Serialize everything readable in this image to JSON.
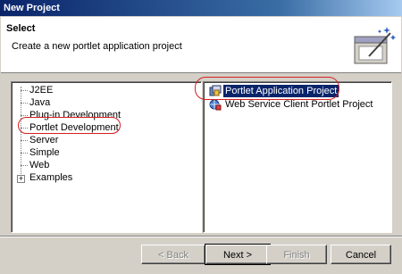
{
  "window": {
    "title": "New Project"
  },
  "banner": {
    "heading": "Select",
    "description": "Create a new portlet application project"
  },
  "categories": [
    {
      "label": "J2EE"
    },
    {
      "label": "Java"
    },
    {
      "label": "Plug-in Development"
    },
    {
      "label": "Portlet Development"
    },
    {
      "label": "Server"
    },
    {
      "label": "Simple"
    },
    {
      "label": "Web"
    },
    {
      "label": "Examples"
    }
  ],
  "projects": [
    {
      "label": "Portlet Application Project"
    },
    {
      "label": "Web Service Client Portlet Project"
    }
  ],
  "buttons": {
    "back": "< Back",
    "next": "Next >",
    "finish": "Finish",
    "cancel": "Cancel"
  },
  "colors": {
    "selection": "#0a246a",
    "annotation": "#d62020"
  }
}
